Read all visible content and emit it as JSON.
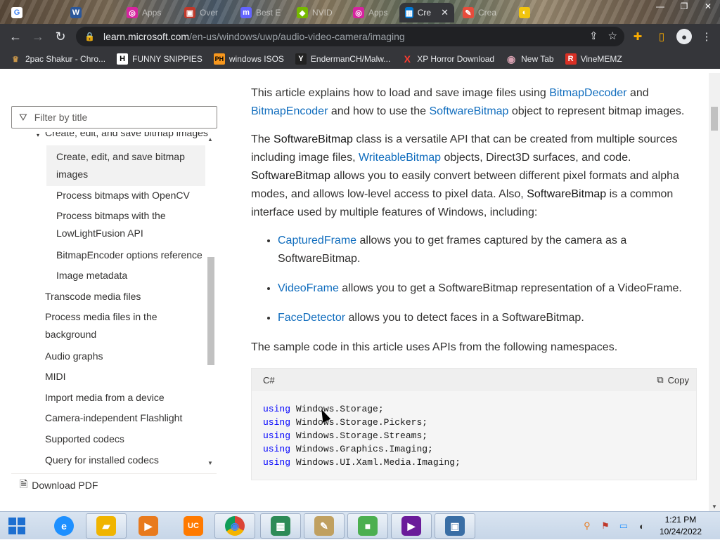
{
  "tabs": [
    {
      "label": "",
      "fav": "G",
      "color": "#4285f4"
    },
    {
      "label": "",
      "fav": "W",
      "color": "#2b579a"
    },
    {
      "label": "Apps",
      "fav": "◎",
      "color": "#d6249f"
    },
    {
      "label": "Over",
      "fav": "▣",
      "color": "#c0392b"
    },
    {
      "label": "Best E",
      "fav": "m",
      "color": "#6364ff"
    },
    {
      "label": "NVID",
      "fav": "◆",
      "color": "#76b900"
    },
    {
      "label": "Apps",
      "fav": "◎",
      "color": "#d6249f"
    },
    {
      "label": "Cre",
      "fav": "▦",
      "color": "#0078d4"
    },
    {
      "label": "Crea",
      "fav": "✎",
      "color": "#e74c3c"
    },
    {
      "label": "",
      "fav": "◐",
      "color": "#f1c40f"
    }
  ],
  "address": {
    "domain": "learn.microsoft.com",
    "path": "/en-us/windows/uwp/audio-video-camera/imaging"
  },
  "bookmarks": [
    {
      "label": "2pac Shakur - Chro...",
      "icon": "♛",
      "color": "#8b5a2b"
    },
    {
      "label": "FUNNY SNIPPIES",
      "icon": "H",
      "color": "#ffffff"
    },
    {
      "label": "windows ISOS",
      "icon": "PH",
      "color": "#f7971d"
    },
    {
      "label": "EndermanCH/Malw...",
      "icon": "Y",
      "color": "#333333"
    },
    {
      "label": "XP Horror Download",
      "icon": "X",
      "color": "#ff3b30"
    },
    {
      "label": "New Tab",
      "icon": "◉",
      "color": "#b07a8a"
    },
    {
      "label": "VineMEMZ",
      "icon": "R",
      "color": "#d93025"
    }
  ],
  "sidebar": {
    "filter_placeholder": "Filter by title",
    "items": [
      {
        "label": "Create, edit, and save bitmap images"
      },
      {
        "label": "Create, edit, and save bitmap"
      },
      {
        "label": "images"
      },
      {
        "label": "Process bitmaps with OpenCV"
      },
      {
        "label": "Process bitmaps with the"
      },
      {
        "label": "LowLightFusion API"
      },
      {
        "label": "BitmapEncoder options reference"
      },
      {
        "label": "Image metadata"
      },
      {
        "label": "Transcode media files"
      },
      {
        "label": "Process media files in the"
      },
      {
        "label": "background"
      },
      {
        "label": "Audio graphs"
      },
      {
        "label": "MIDI"
      },
      {
        "label": "Import media from a device"
      },
      {
        "label": "Camera-independent Flashlight"
      },
      {
        "label": "Supported codecs"
      },
      {
        "label": "Query for installed codecs"
      }
    ],
    "download_pdf": "Download PDF"
  },
  "article": {
    "p1": {
      "t1": "This article explains how to load and save image files using ",
      "l1": "BitmapDecoder",
      "t2": " and ",
      "l2": "BitmapEncoder",
      "t3": " and how to use the ",
      "l3": "SoftwareBitmap",
      "t4": " object to represent bitmap images."
    },
    "p2": {
      "t1": "The ",
      "b1": "SoftwareBitmap",
      "t2": " class is a versatile API that can be created from multiple sources including image files, ",
      "l1": "WriteableBitmap",
      "t3": " objects, Direct3D surfaces, and code. ",
      "b2": "SoftwareBitmap",
      "t4": " allows you to easily convert between different pixel formats and alpha modes, and allows low-level access to pixel data. Also, ",
      "b3": "SoftwareBitmap",
      "t5": " is a common interface used by multiple features of Windows, including:"
    },
    "bullets": [
      {
        "link": "CapturedFrame",
        "text": " allows you to get frames captured by the camera as a ",
        "bold": "SoftwareBitmap",
        "end": "."
      },
      {
        "link": "VideoFrame",
        "text": " allows you to get a ",
        "bold": "SoftwareBitmap",
        "mid": " representation of a ",
        "bold2": "VideoFrame",
        "end": "."
      },
      {
        "link": "FaceDetector",
        "text": " allows you to detect faces in a ",
        "bold": "SoftwareBitmap",
        "end": "."
      }
    ],
    "p3": "The sample code in this article uses APIs from the following namespaces.",
    "code": {
      "lang": "C#",
      "copy_label": "Copy",
      "keyword": "using",
      "lines": [
        "Windows.Storage;",
        "Windows.Storage.Pickers;",
        "Windows.Storage.Streams;",
        "Windows.Graphics.Imaging;",
        "Windows.UI.Xaml.Media.Imaging;"
      ]
    }
  },
  "taskbar": {
    "apps": [
      {
        "name": "ie",
        "icon": "e",
        "color": "#1e90ff"
      },
      {
        "name": "explorer",
        "icon": "▰",
        "color": "#f0b400"
      },
      {
        "name": "media",
        "icon": "▶",
        "color": "#e87a1d"
      },
      {
        "name": "uc",
        "icon": "UC",
        "color": "#ff7a00"
      },
      {
        "name": "chrome",
        "icon": "◉",
        "color": "#db4437"
      },
      {
        "name": "app6",
        "icon": "▦",
        "color": "#2e8b57"
      },
      {
        "name": "paint",
        "icon": "✎",
        "color": "#c0a060"
      },
      {
        "name": "minecraft",
        "icon": "■",
        "color": "#4caf50"
      },
      {
        "name": "app9",
        "icon": "▶",
        "color": "#6a1b9a"
      },
      {
        "name": "app10",
        "icon": "▣",
        "color": "#3a6ea5"
      }
    ],
    "time": "1:21 PM",
    "date": "10/24/2022"
  }
}
